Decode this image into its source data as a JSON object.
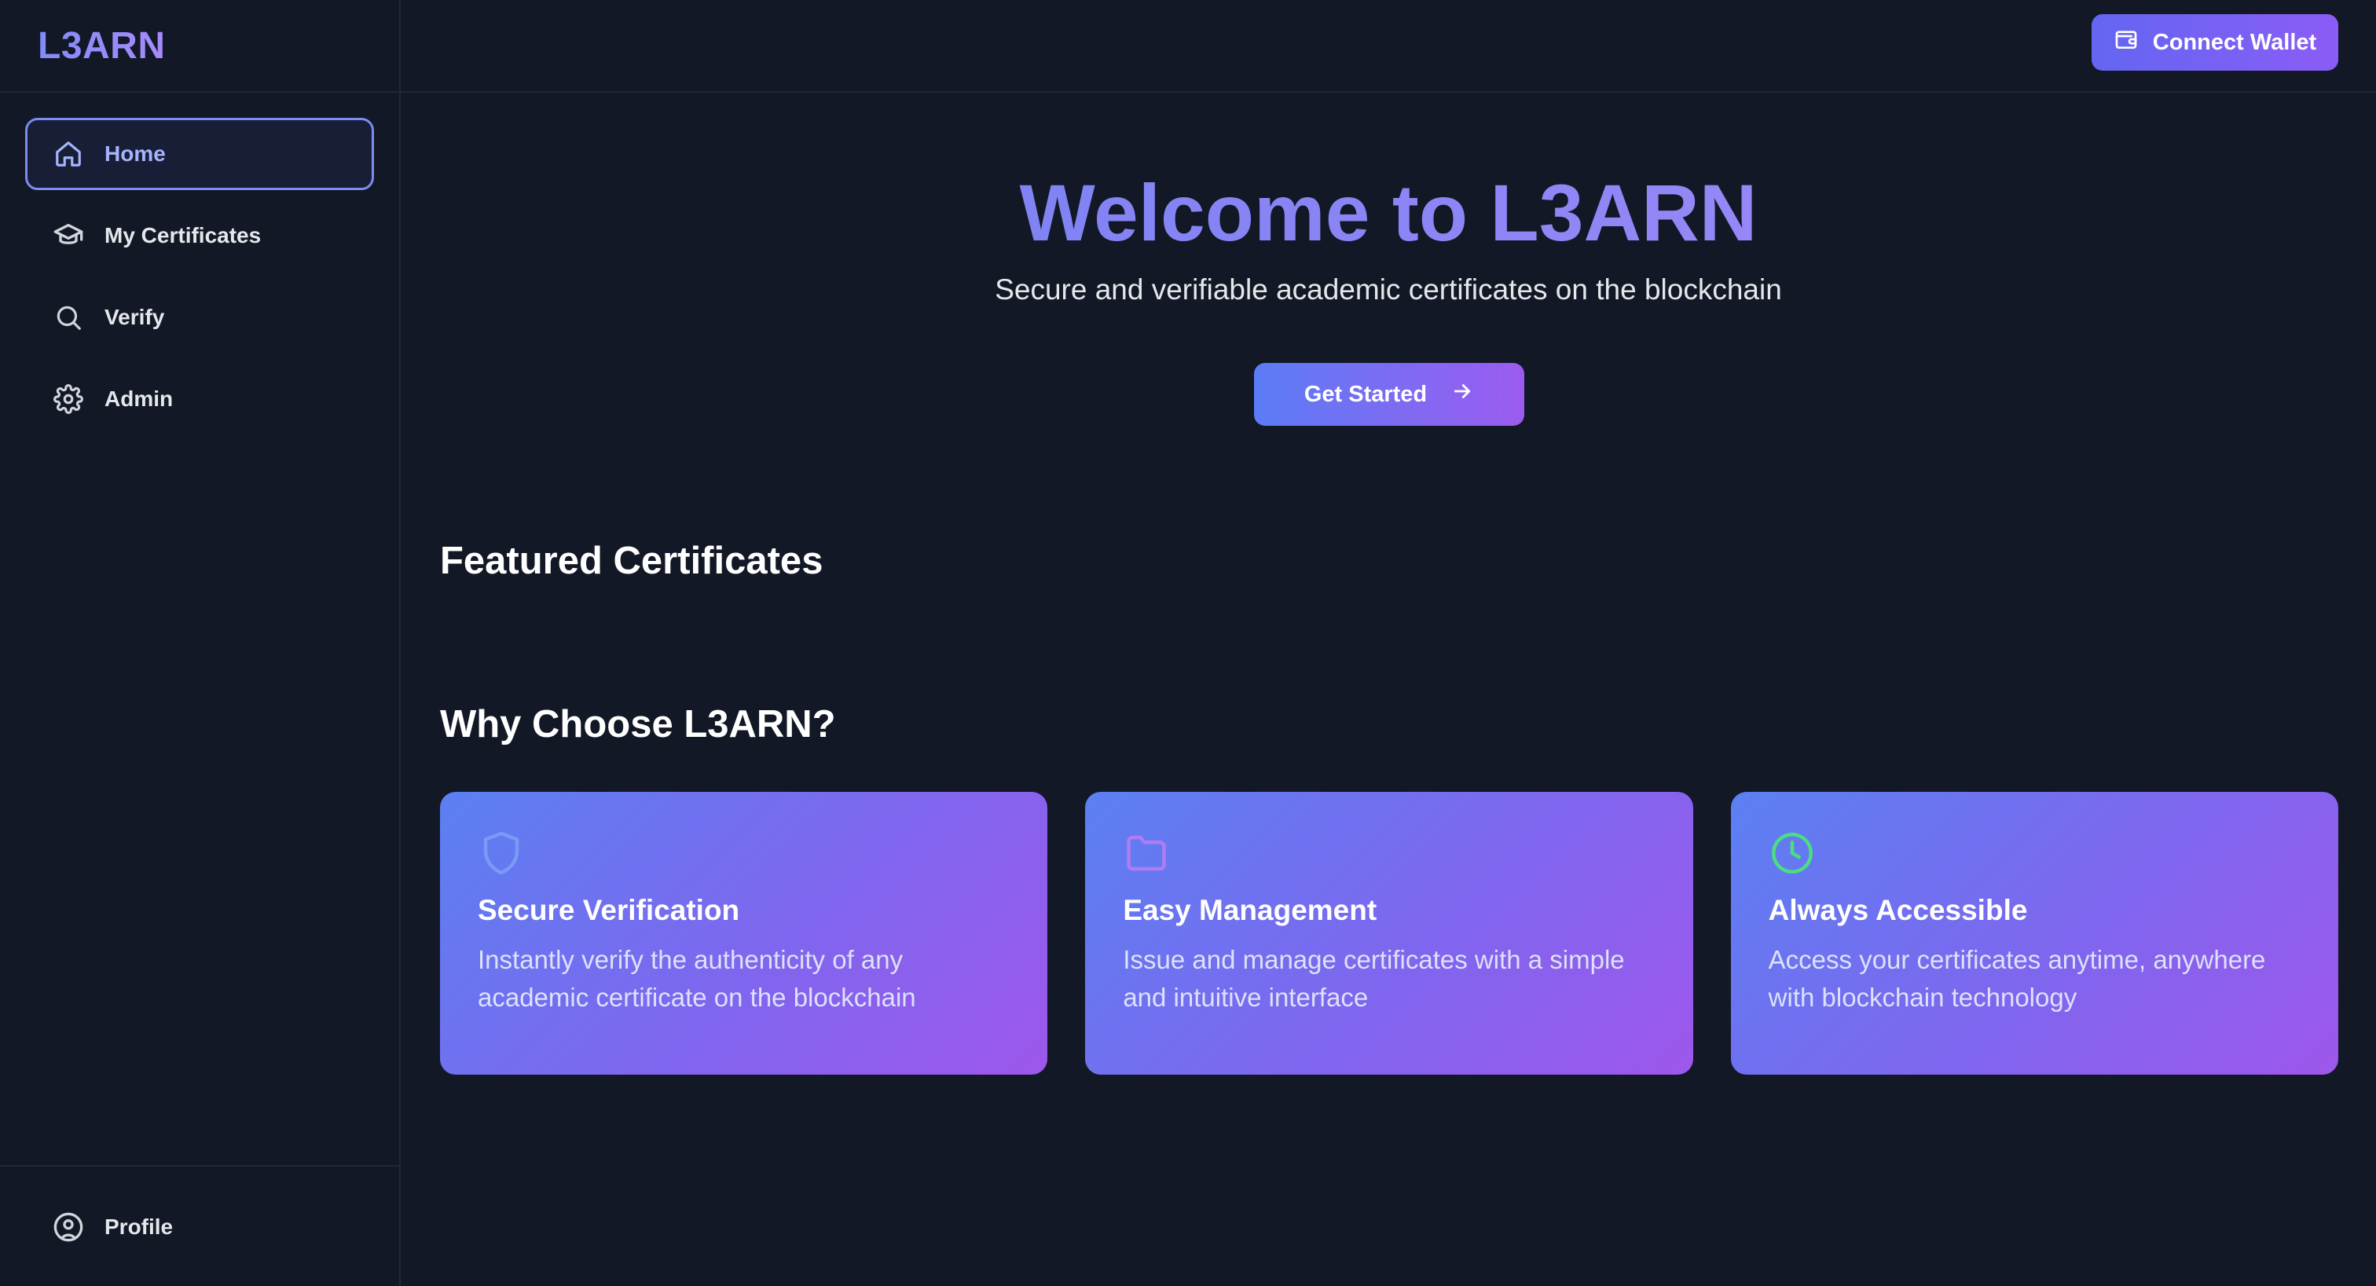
{
  "app": {
    "logo": "L3ARN"
  },
  "sidebar": {
    "items": [
      {
        "label": "Home",
        "icon": "home-icon",
        "active": true
      },
      {
        "label": "My Certificates",
        "icon": "graduation-cap-icon",
        "active": false
      },
      {
        "label": "Verify",
        "icon": "search-icon",
        "active": false
      },
      {
        "label": "Admin",
        "icon": "gear-icon",
        "active": false
      }
    ],
    "profile_label": "Profile"
  },
  "topbar": {
    "connect_label": "Connect Wallet"
  },
  "hero": {
    "title": "Welcome to L3ARN",
    "subtitle": "Secure and verifiable academic certificates on the blockchain",
    "cta_label": "Get Started"
  },
  "sections": {
    "featured_title": "Featured Certificates",
    "why_title": "Why Choose L3ARN?"
  },
  "features": [
    {
      "icon": "shield-icon",
      "title": "Secure Verification",
      "description": "Instantly verify the authenticity of any academic certificate on the blockchain",
      "icon_color": "#7b9af5"
    },
    {
      "icon": "folder-icon",
      "title": "Easy Management",
      "description": "Issue and manage certificates with a simple and intuitive interface",
      "icon_color": "#b07cf3"
    },
    {
      "icon": "clock-icon",
      "title": "Always Accessible",
      "description": "Access your certificates anytime, anywhere with blockchain technology",
      "icon_color": "#4ade80"
    }
  ],
  "colors": {
    "background": "#121826",
    "accent_start": "#6366f1",
    "accent_end": "#8b5cf6"
  }
}
